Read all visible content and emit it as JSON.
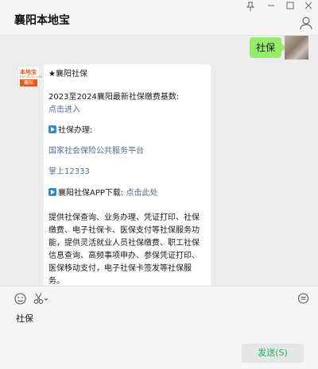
{
  "window": {
    "title": "襄阳本地宝",
    "controls": [
      "pin-icon",
      "minimize-icon",
      "maximize-icon",
      "close-icon"
    ]
  },
  "messages": {
    "sent": {
      "text": "社保"
    },
    "received": {
      "avatar": {
        "line1": "本地宝",
        "line2": "bendibao.com",
        "line3": "襄阳"
      },
      "header": "★襄阳社保",
      "line_base": "2023至2024襄阳最新社保缴费基数:",
      "link_enter": "点击进入",
      "section_label": "社保办理:",
      "link_platform": "国家社会保险公共服务平台",
      "link_app": "掌上12333",
      "download_label": "襄阳社保APP下载:",
      "link_download": "点击此处",
      "description": "提供社保查询、业务办理、凭证打印、社保缴费、电子社保卡、医保支付等社保服务功能，提供灵活就业人员社保缴费、职工社保信息查询、高频事项申办、参保凭证打印、医保移动支付，电子社保卡签发等社保服务。"
    }
  },
  "input": {
    "value": "社保",
    "send_label": "发送(S)"
  },
  "colors": {
    "sent_bubble": "#95ec69",
    "link": "#576b95",
    "send_text": "#07c160"
  }
}
